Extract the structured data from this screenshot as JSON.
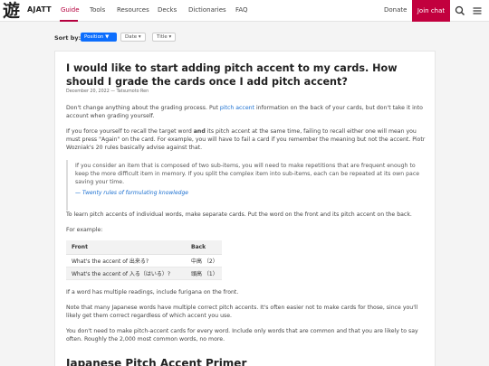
{
  "nav": {
    "logo_kanji": "遊",
    "logo_text": "AJATT",
    "links": [
      "Guide",
      "Tools",
      "Resources",
      "Decks",
      "Dictionaries",
      "FAQ"
    ],
    "donate": "Donate",
    "join": "Join chat",
    "accent": "#c2003e"
  },
  "sort": {
    "label": "Sort by:",
    "position": "Position ▼",
    "date": "Date ▾",
    "title": "Title ▾",
    "accent": "#0d6efd"
  },
  "article": {
    "title": "I would like to start adding pitch accent to my cards. How should I grade the cards once I add pitch accent?",
    "meta": "December 20, 2022 — Tatsumoto Ren",
    "p1_a": "Don't change anything about the grading process. Put ",
    "p1_link": "pitch accent",
    "p1_b": " information on the back of your cards, but don't take it into account when grading yourself.",
    "p2_a": "If you force yourself to recall the target word ",
    "p2_bold": "and",
    "p2_b": " its pitch accent at the same time, failing to recall either one will mean you must press \"Again\" on the card. For example, you will have to fail a card if you remember the meaning but not the accent. Piotr Wozniak's 20 rules basically advise against that.",
    "quote_text": "If you consider an item that is composed of two sub-items, you will need to make repetitions that are frequent enough to keep the more difficult item in memory. If you split the complex item into sub-items, each can be repeated at its own pace saving your time.",
    "quote_cite": "— Twenty rules of formulating knowledge",
    "p3": "To learn pitch accents of individual words, make separate cards. Put the word on the front and its pitch accent on the back.",
    "p4": "For example:",
    "table": {
      "headers": [
        "Front",
        "Back"
      ],
      "rows": [
        [
          "What's the accent of 出来る?",
          "中高 （2）"
        ],
        [
          "What's the accent of 入る（はいる）?",
          "頭高 （1）"
        ]
      ]
    },
    "p5": "If a word has multiple readings, include furigana on the front.",
    "p6": "Note that many Japanese words have multiple correct pitch accents. It's often easier not to make cards for those, since you'll likely get them correct regardless of which accent you use.",
    "p7": "You don't need to make pitch-accent cards for every word. Include only words that are common and that you are likely to say often. Roughly the 2,000 most common words, no more.",
    "h2": "Japanese Pitch Accent Primer"
  }
}
